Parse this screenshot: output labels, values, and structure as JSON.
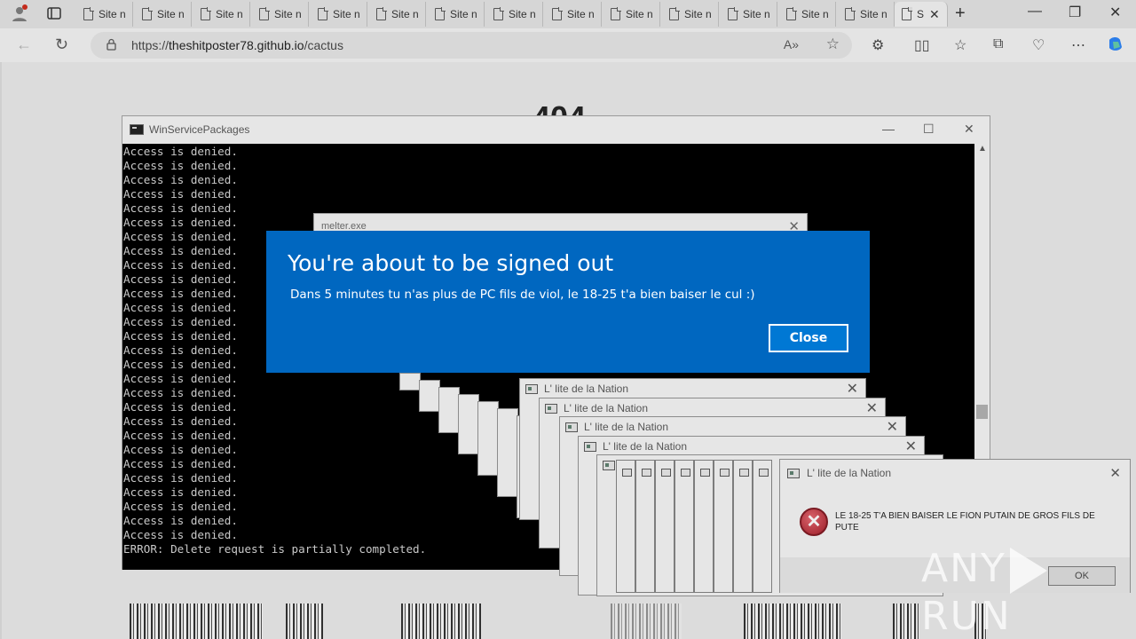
{
  "browser": {
    "tabs": [
      "Site n",
      "Site n",
      "Site n",
      "Site n",
      "Site n",
      "Site n",
      "Site n",
      "Site n",
      "Site n",
      "Site n",
      "Site n",
      "Site n",
      "Site n",
      "Site n"
    ],
    "active_tab_label": "S",
    "url_host": "theshitposter78.github.io",
    "url_path": "/cactus",
    "url_prefix": "https://"
  },
  "page": {
    "heading_partial": "404"
  },
  "console": {
    "title": "WinServicePackages",
    "lines": [
      "Access is denied.",
      "Access is denied.",
      "Access is denied.",
      "Access is denied.",
      "Access is denied.",
      "Access is denied.",
      "Access is denied.",
      "Access is denied.",
      "Access is denied.",
      "Access is denied.",
      "Access is denied.",
      "Access is denied.",
      "Access is denied.",
      "Access is denied.",
      "Access is denied.",
      "Access is denied.",
      "Access is denied.",
      "Access is denied.",
      "Access is denied.",
      "Access is denied.",
      "Access is denied.",
      "Access is denied.",
      "Access is denied.",
      "Access is denied.",
      "Access is denied.",
      "Access is denied.",
      "Access is denied.",
      "Access is denied.",
      "ERROR: Delete request is partially completed."
    ]
  },
  "melter": {
    "title": "melter.exe"
  },
  "error_windows": {
    "title": "L' lite de la Nation",
    "message": "LE 18-25 T'A BIEN BAISER LE FION PUTAIN DE GROS FILS DE PUTE",
    "ok_label": "OK"
  },
  "toast": {
    "title": "You're about to be signed out",
    "message": "Dans 5 minutes tu n'as plus de PC fils de viol, le 18-25 t'a bien baiser le cul :)",
    "close_label": "Close"
  },
  "watermark": {
    "left": "ANY",
    "right": "RUN"
  }
}
